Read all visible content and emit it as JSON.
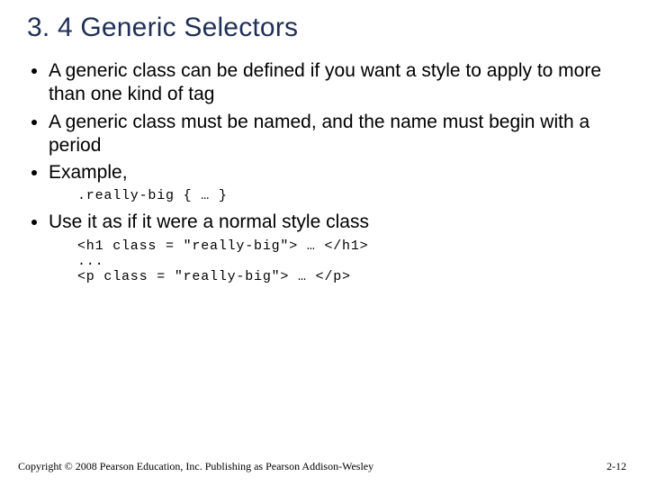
{
  "title": "3. 4 Generic Selectors",
  "bullets": {
    "b1": "A generic class can be defined if you want a style to apply to more than one kind of tag",
    "b2": "A generic class must be named, and the name must begin with a period",
    "b3": "Example,",
    "b4": "Use it as if it were a normal style class"
  },
  "code": {
    "c1": ".really-big { … }",
    "c2": "<h1 class = \"really-big\"> … </h1>\n...\n<p class = \"really-big\"> … </p>"
  },
  "footer": "Copyright © 2008 Pearson Education, Inc. Publishing as Pearson Addison-Wesley",
  "pagenum": "2-12"
}
